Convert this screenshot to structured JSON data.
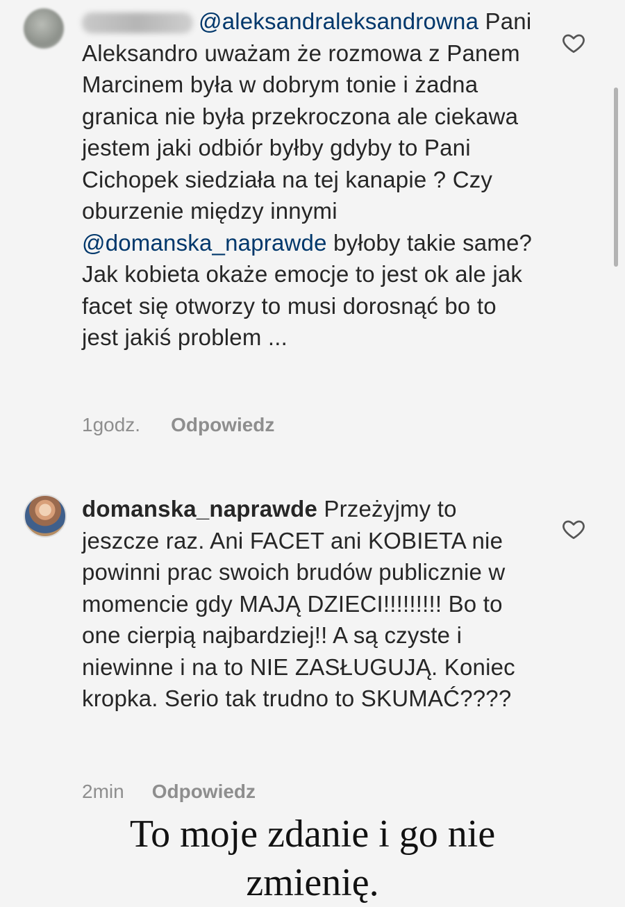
{
  "comments": [
    {
      "mention": "@aleksandraleksandrowna",
      "text": "Pani Aleksandro uważam że rozmowa z Panem Marcinem była w dobrym tonie i żadna granica nie była przekroczona ale ciekawa jestem jaki odbiór byłby gdyby to Pani Cichopek siedziała na tej kanapie ? Czy oburzenie między innymi",
      "mention2": "@domanska_naprawde",
      "text2": "byłoby takie same? Jak kobieta okaże emocje to jest ok ale jak facet się otworzy to musi dorosnąć bo to jest jakiś problem ...",
      "time": "1godz.",
      "reply_label": "Odpowiedz",
      "like_icon": "heart-outline-icon"
    },
    {
      "username": "domanska_naprawde",
      "text": "Przeżyjmy to jeszcze raz. Ani FACET ani KOBIETA nie powinni prac swoich brudów publicznie w momencie gdy MAJĄ DZIECI!!!!!!!!! Bo to one cierpią najbardziej!! A są czyste i niewinne i na to NIE ZASŁUGUJĄ. Koniec kropka. Serio tak trudno to SKUMAĆ????",
      "time": "2min",
      "reply_label": "Odpowiedz",
      "like_icon": "heart-outline-icon"
    }
  ],
  "caption": {
    "line1": "To moje zdanie i go nie",
    "line2": "zmienię."
  },
  "colors": {
    "background": "#f4f4f4",
    "text": "#262626",
    "mention": "#00376b",
    "meta": "#8e8e8e"
  }
}
